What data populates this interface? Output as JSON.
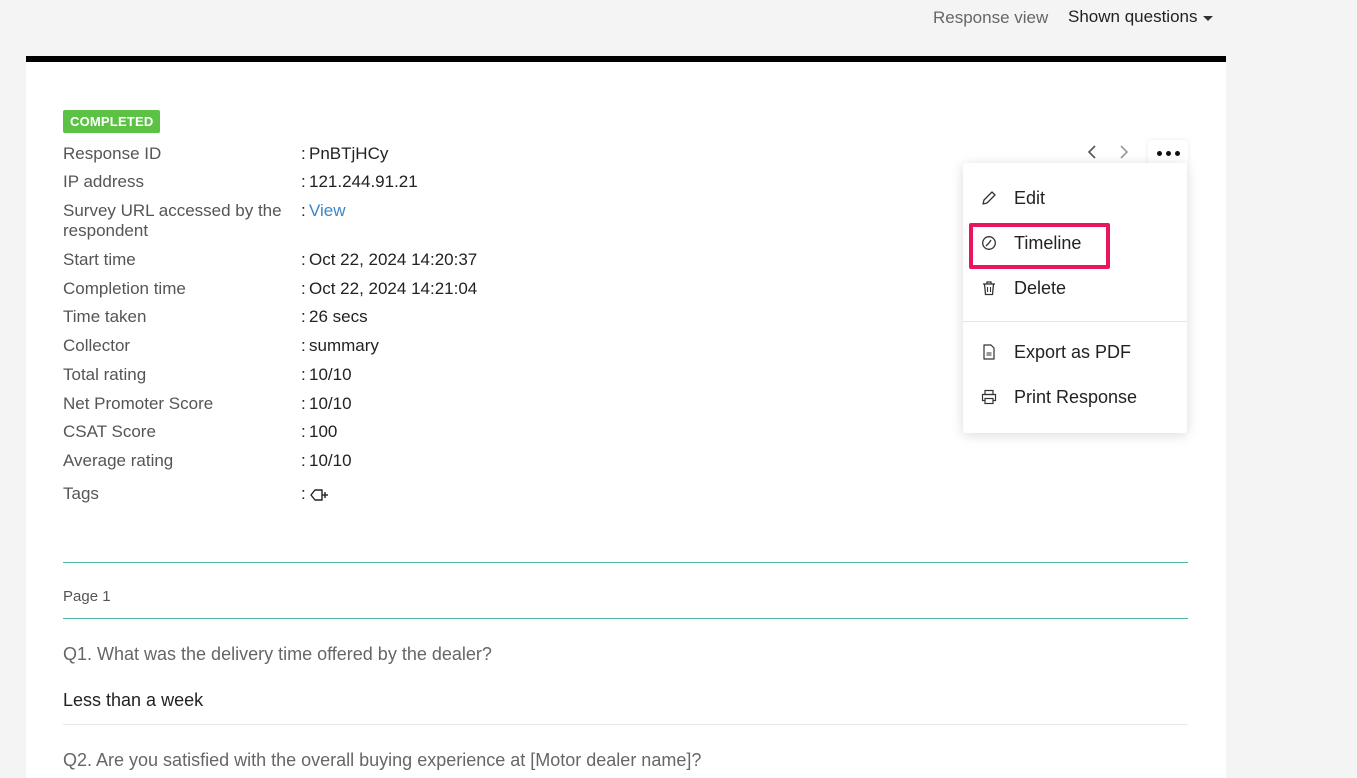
{
  "header": {
    "response_view_label": "Response view",
    "shown_questions_label": "Shown questions"
  },
  "status_badge": "COMPLETED",
  "details": [
    {
      "label": "Response ID",
      "sep": ":",
      "value": "PnBTjHCy"
    },
    {
      "label": "IP address",
      "sep": ":",
      "value": "121.244.91.21"
    },
    {
      "label": "Survey URL accessed by the respondent",
      "sep": ":",
      "value": "View"
    },
    {
      "label": "Start time",
      "sep": ":",
      "value": "Oct 22, 2024 14:20:37"
    },
    {
      "label": "Completion time",
      "sep": ":",
      "value": "Oct 22, 2024 14:21:04"
    },
    {
      "label": "Time taken",
      "sep": ":",
      "value": "26 secs"
    },
    {
      "label": "Collector",
      "sep": ":",
      "value": "summary"
    },
    {
      "label": "Total rating",
      "sep": ":",
      "value": "10/10"
    },
    {
      "label": "Net Promoter Score",
      "sep": ":",
      "value": "10/10"
    },
    {
      "label": "CSAT Score",
      "sep": ":",
      "value": "100"
    },
    {
      "label": "Average rating",
      "sep": ":",
      "value": "10/10"
    },
    {
      "label": "Tags",
      "sep": ":",
      "value": ""
    }
  ],
  "menu": {
    "items": [
      {
        "label": "Edit",
        "icon": "pencil-icon"
      },
      {
        "label": "Timeline",
        "icon": "clock-icon"
      },
      {
        "label": "Delete",
        "icon": "trash-icon"
      },
      {
        "label": "Export as PDF",
        "icon": "pdf-icon"
      },
      {
        "label": "Print Response",
        "icon": "printer-icon"
      }
    ],
    "highlight_color": "#e8175d"
  },
  "page": {
    "label": "Page 1",
    "questions": [
      {
        "question": "Q1. What was the delivery time offered by the dealer?",
        "answer": "Less than a week"
      },
      {
        "question": "Q2. Are you satisfied with the overall buying experience at [Motor dealer name]?",
        "answer": ""
      }
    ]
  },
  "colors": {
    "badge": "#5cc245",
    "link": "#3a86c8",
    "divider": "#4db6a8"
  }
}
